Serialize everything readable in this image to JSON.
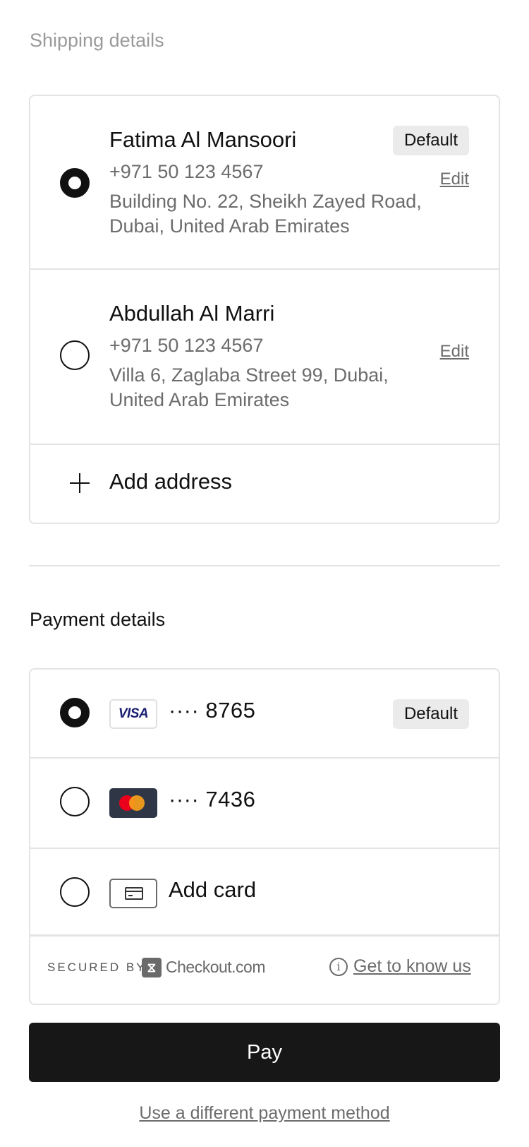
{
  "shipping": {
    "title": "Shipping details",
    "addresses": [
      {
        "name": "Fatima Al Mansoori",
        "phone": "+971 50 123 4567",
        "address": "Building No. 22, Sheikh Zayed Road, Dubai, United Arab Emirates",
        "badge": "Default",
        "edit_label": "Edit",
        "selected": true
      },
      {
        "name": "Abdullah Al Marri",
        "phone": "+971 50 123 4567",
        "address": "Villa 6, Zaglaba Street 99, Dubai, United Arab Emirates",
        "edit_label": "Edit",
        "selected": false
      }
    ],
    "add_address_label": "Add address"
  },
  "payment": {
    "title": "Payment details",
    "cards": [
      {
        "brand_icon": "visa-logo",
        "brand_text": "VISA",
        "masked": "···· 8765",
        "badge": "Default",
        "selected": true
      },
      {
        "brand_icon": "mastercard-logo",
        "masked": "···· 7436",
        "selected": false
      }
    ],
    "add_card_label": "Add card",
    "secured_by_label": "SECURED BY",
    "provider_name": "Checkout.com",
    "get_to_know_label": "Get to know us"
  },
  "actions": {
    "pay_label": "Pay",
    "different_method_label": "Use a different payment method"
  },
  "colors": {
    "primary_button": "#171717",
    "border": "#e4e4e4",
    "muted_text": "#6c6c6c",
    "badge_bg": "#ebebeb"
  }
}
